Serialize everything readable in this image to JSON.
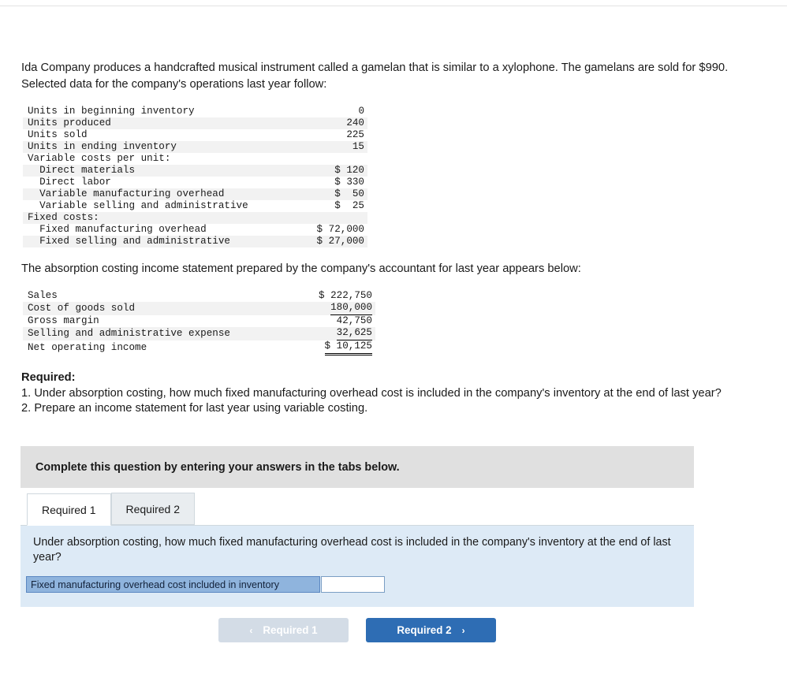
{
  "intro": "Ida Company produces a handcrafted musical instrument called a gamelan that is similar to a xylophone. The gamelans are sold for $990. Selected data for the company's operations last year follow:",
  "data_table": {
    "rows": [
      {
        "label": "Units in beginning inventory",
        "value": "0",
        "zebra": false,
        "indent": 0
      },
      {
        "label": "Units produced",
        "value": "240",
        "zebra": true,
        "indent": 0
      },
      {
        "label": "Units sold",
        "value": "225",
        "zebra": false,
        "indent": 0
      },
      {
        "label": "Units in ending inventory",
        "value": "15",
        "zebra": true,
        "indent": 0
      },
      {
        "label": "Variable costs per unit:",
        "value": "",
        "zebra": false,
        "indent": 0
      },
      {
        "label": "  Direct materials",
        "value": "$ 120",
        "zebra": true,
        "indent": 1
      },
      {
        "label": "  Direct labor",
        "value": "$ 330",
        "zebra": false,
        "indent": 1
      },
      {
        "label": "  Variable manufacturing overhead",
        "value": "$  50",
        "zebra": true,
        "indent": 1
      },
      {
        "label": "  Variable selling and administrative",
        "value": "$  25",
        "zebra": false,
        "indent": 1
      },
      {
        "label": "Fixed costs:",
        "value": "",
        "zebra": true,
        "indent": 0
      },
      {
        "label": "  Fixed manufacturing overhead",
        "value": "$ 72,000",
        "zebra": false,
        "indent": 1
      },
      {
        "label": "  Fixed selling and administrative",
        "value": "$ 27,000",
        "zebra": true,
        "indent": 1
      }
    ]
  },
  "absorption_intro": "The absorption costing income statement prepared by the company's accountant for last year appears below:",
  "income_statement": {
    "rows": [
      {
        "label": "Sales",
        "value": "$ 222,750",
        "zebra": false,
        "rule": "none"
      },
      {
        "label": "Cost of goods sold",
        "value": "180,000",
        "zebra": true,
        "rule": "single"
      },
      {
        "label": "Gross margin",
        "value": "42,750",
        "zebra": false,
        "rule": "none"
      },
      {
        "label": "Selling and administrative expense",
        "value": "32,625",
        "zebra": true,
        "rule": "single"
      },
      {
        "label": "Net operating income",
        "value": "$ 10,125",
        "zebra": false,
        "rule": "double"
      }
    ]
  },
  "required": {
    "title": "Required:",
    "item1": "1. Under absorption costing, how much fixed manufacturing overhead cost is included in the company's inventory at the end of last year?",
    "item2": "2. Prepare an income statement for last year using variable costing."
  },
  "widget": {
    "header": "Complete this question by entering your answers in the tabs below.",
    "tabs": [
      {
        "label": "Required 1",
        "active": true
      },
      {
        "label": "Required 2",
        "active": false
      }
    ],
    "question": "Under absorption costing, how much fixed manufacturing overhead cost is included in the company's inventory at the end of last year?",
    "answer_label": "Fixed manufacturing overhead cost included in inventory",
    "answer_value": "",
    "answer_placeholder": "",
    "prev_button": "Required 1",
    "next_button": "Required 2",
    "prev_chevron": "‹",
    "next_chevron": "›"
  },
  "colors": {
    "accent": "#2e6db4",
    "question_band": "#ddeaf6",
    "answer_label": "#8fb4dd",
    "header_band": "#e0e0e0"
  }
}
